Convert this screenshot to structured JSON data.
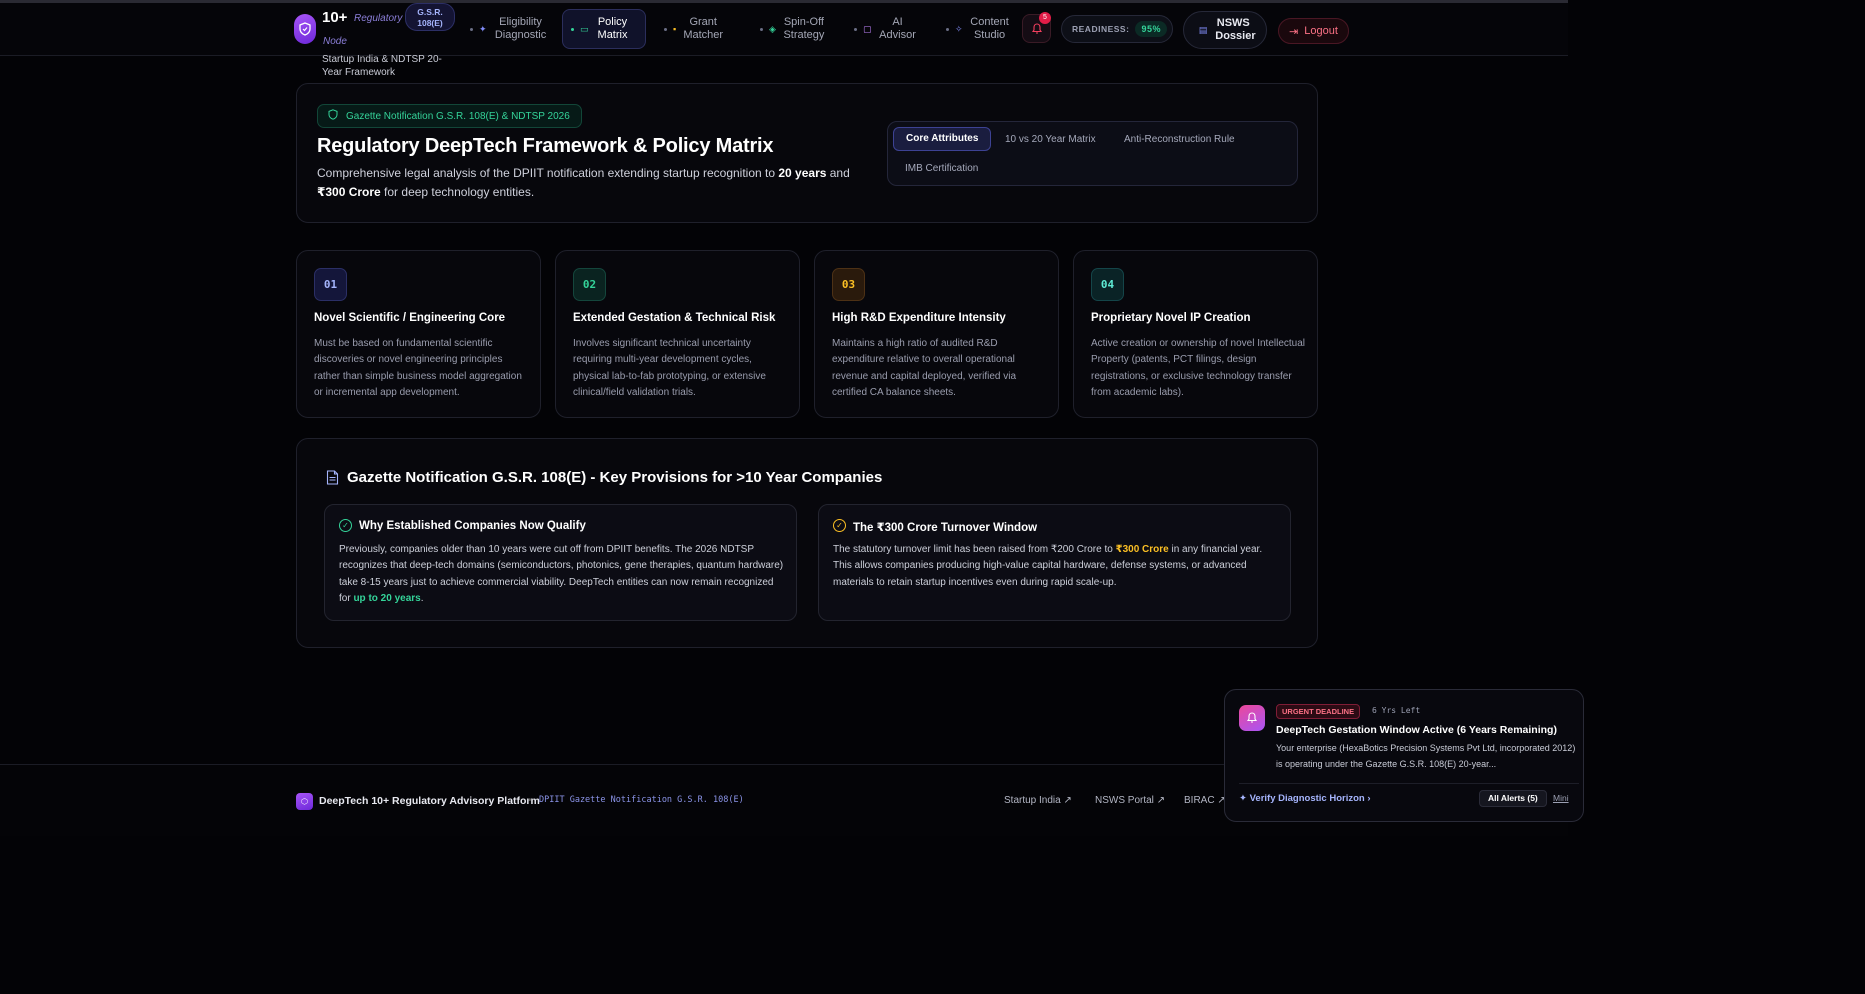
{
  "nav": {
    "brand_number": "10+",
    "brand_tag": "Regulatory",
    "brand_node": "Node",
    "brand_subtitle": "Startup India & NDTSP 20-Year Framework",
    "gsr_pill": "G.S.R. 108(E)",
    "items": [
      {
        "label": "Eligibility Diagnostic",
        "icon": "sparkle-icon",
        "active": false
      },
      {
        "label": "Policy Matrix",
        "icon": "document-icon",
        "active": true
      },
      {
        "label": "Grant Matcher",
        "icon": "lock-icon",
        "active": false
      },
      {
        "label": "Spin-Off Strategy",
        "icon": "layers-icon",
        "active": false
      },
      {
        "label": "AI Advisor",
        "icon": "chat-icon",
        "active": false
      },
      {
        "label": "Content Studio",
        "icon": "wand-icon",
        "active": false
      }
    ],
    "notifications_count": "5",
    "readiness_label": "READINESS:",
    "readiness_value": "95%",
    "nsws_label": "NSWS Dossier",
    "logout_label": "Logout"
  },
  "hero": {
    "badge": "Gazette Notification G.S.R. 108(E) & NDTSP 2026",
    "title": "Regulatory DeepTech Framework & Policy Matrix",
    "desc_part1": "Comprehensive legal analysis of the DPIIT notification extending startup recognition to ",
    "desc_bold1": "20 years",
    "desc_part2": " and ",
    "desc_bold2": "₹300 Crore",
    "desc_part3": " for deep technology entities.",
    "tabs": [
      "Core Attributes",
      "10 vs 20 Year Matrix",
      "Anti-Reconstruction Rule",
      "IMB Certification"
    ]
  },
  "attributes": [
    {
      "num": "01",
      "title": "Novel Scientific / Engineering Core",
      "desc": "Must be based on fundamental scientific discoveries or novel engineering principles rather than simple business model aggregation or incremental app development.",
      "color": "#a5b4fc",
      "bg": "#14163a",
      "border": "#2b2f66"
    },
    {
      "num": "02",
      "title": "Extended Gestation & Technical Risk",
      "desc": "Involves significant technical uncertainty requiring multi-year development cycles, physical lab-to-fab prototyping, or extensive clinical/field validation trials.",
      "color": "#34d399",
      "bg": "#0a2320",
      "border": "#14463c"
    },
    {
      "num": "03",
      "title": "High R&D Expenditure Intensity",
      "desc": "Maintains a high ratio of audited R&D expenditure relative to overall operational revenue and capital deployed, verified via certified CA balance sheets.",
      "color": "#fbbf24",
      "bg": "#2a1a0c",
      "border": "#4d3115"
    },
    {
      "num": "04",
      "title": "Proprietary Novel IP Creation",
      "desc": "Active creation or ownership of novel Intellectual Property (patents, PCT filings, design registrations, or exclusive technology transfer from academic labs).",
      "color": "#5eead4",
      "bg": "#0a2326",
      "border": "#144549"
    }
  ],
  "provisions": {
    "title": "Gazette Notification G.S.R. 108(E) - Key Provisions for >10 Year Companies",
    "left": {
      "title": "Why Established Companies Now Qualify",
      "text": "Previously, companies older than 10 years were cut off from DPIIT benefits. The 2026 NDTSP recognizes that deep-tech domains (semiconductors, photonics, gene therapies, quantum hardware) take 8-15 years just to achieve commercial viability. DeepTech entities can now remain recognized for ",
      "highlight": "up to 20 years",
      "end": "."
    },
    "right": {
      "title": "The ₹300 Crore Turnover Window",
      "text1": "The statutory turnover limit has been raised from ₹200 Crore to ",
      "highlight": "₹300 Crore",
      "text2": " in any financial year. This allows companies producing high-value capital hardware, defense systems, or advanced materials to retain startup incentives even during rapid scale-up."
    }
  },
  "footer": {
    "name": "DeepTech 10+ Regulatory Advisory Platform",
    "separator": "•",
    "gazette": "DPIIT Gazette Notification G.S.R. 108(E)",
    "links": [
      "Startup India",
      "NSWS Portal",
      "BIRAC"
    ]
  },
  "toast": {
    "badge": "URGENT DEADLINE",
    "time": "6 Yrs Left",
    "title": "DeepTech Gestation Window Active (6 Years Remaining)",
    "body": "Your enterprise (HexaBotics Precision Systems Pvt Ltd, incorporated 2012) is operating under the Gazette G.S.R. 108(E) 20-year...",
    "verify": "Verify Diagnostic Horizon",
    "alerts": "All Alerts (5)",
    "mini": "Mini"
  },
  "colors": {
    "accent": "#a855f7",
    "green": "#34d399",
    "amber": "#fbbf24",
    "danger": "#fb7185"
  }
}
